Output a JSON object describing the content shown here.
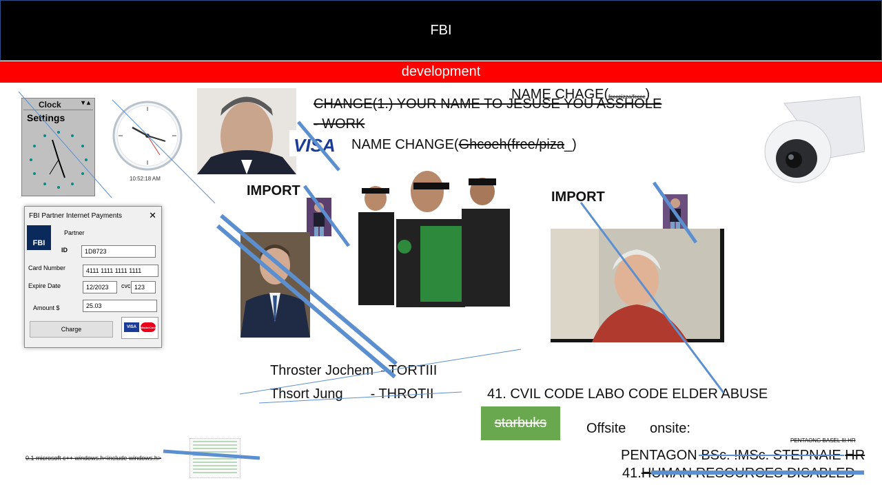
{
  "header": {
    "title": "FBI"
  },
  "banner": {
    "text": "development"
  },
  "old_clock": {
    "title": "Clock",
    "menu": "Settings"
  },
  "digital_clock": {
    "time": "10:52:18 AM"
  },
  "texts": {
    "change1": "CHANGE(1.) YOUR NAME TO JESUSE YOU ASSHOLE",
    "work": "- WORK",
    "name_chage_prefix": "NAME CHAGE(",
    "name_chage_small": "fcccpizza/fcccc",
    "name_chage_suffix": ")",
    "name_change_prefix": "NAME CHANGE(",
    "name_change_struck": "Ghcoeh(free/piza",
    "name_change_suffix": "_)",
    "import_left": "IMPORT",
    "import_right": "IMPORT",
    "name1": "Throster Jochem",
    "tag1": "- TORTIII",
    "name2": "Thsort Jung",
    "tag2": "- THROTII",
    "civil_code": "41. CVIL CODE LABO CODE ELDER ABUSE",
    "starbuks": "starbuks",
    "offsite": "Offsite",
    "onsite": "onsite:",
    "pentagon_small": "PENTAONG BASEL III HR",
    "pentagon_prefix": "PENTAGON",
    "pentagon_struck": "BSc. !MSc.",
    "pentagon_mid": "STEPNAIE",
    "pentagon_hr": "HR",
    "hr_prefix": "41.",
    "hr_struck": "HUMAN RESOURCES DISABLED",
    "windows_h": "0.1 microsoft c++ windows.h<include windows.h>"
  },
  "visa": "VISA",
  "payment_dialog": {
    "title": "FBI Partner Internet Payments",
    "logo_text": "FBI",
    "partner_label": "Partner",
    "id_label": "ID",
    "id_value": "1D8723",
    "card_label": "Card Number",
    "card_value": "4111 1111 1111 1111",
    "expire_label": "Expire Date",
    "expire_value": "12/2023",
    "cvc_label": "cvc",
    "cvc_value": "123",
    "amount_label": "Amount $",
    "amount_value": "25.03",
    "charge_button": "Charge",
    "card_logos": [
      "VISA",
      "MasterCard"
    ]
  },
  "colors": {
    "header_bg": "#000000",
    "banner_bg": "#ff0000",
    "line_blue": "#5b8fcf",
    "starbuks_bg": "#6aa84f"
  }
}
